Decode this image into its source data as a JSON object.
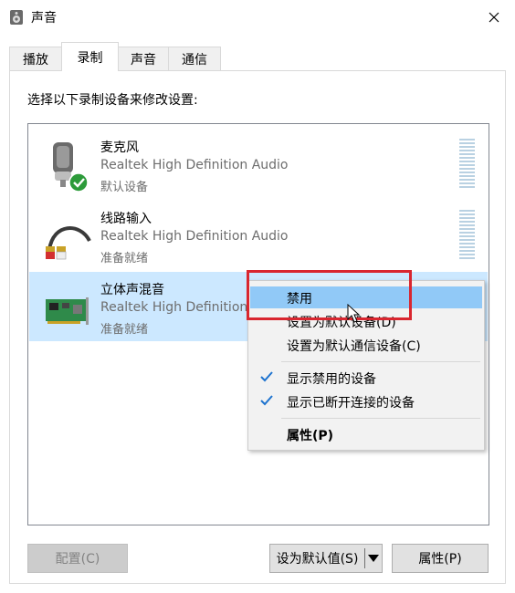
{
  "window": {
    "title": "声音"
  },
  "tabs": [
    {
      "label": "播放"
    },
    {
      "label": "录制"
    },
    {
      "label": "声音"
    },
    {
      "label": "通信"
    }
  ],
  "instruction": "选择以下录制设备来修改设置:",
  "devices": [
    {
      "name": "麦克风",
      "description": "Realtek High Definition Audio",
      "status": "默认设备",
      "icon": "microphone-icon"
    },
    {
      "name": "线路输入",
      "description": "Realtek High Definition Audio",
      "status": "准备就绪",
      "icon": "line-in-cable-icon"
    },
    {
      "name": "立体声混音",
      "description": "Realtek High Definition",
      "status": "准备就绪",
      "icon": "sound-card-icon"
    }
  ],
  "context_menu": {
    "items": [
      {
        "label": "禁用"
      },
      {
        "label": "设置为默认设备(D)"
      },
      {
        "label": "设置为默认通信设备(C)"
      },
      {
        "label": "显示禁用的设备",
        "checked": true
      },
      {
        "label": "显示已断开连接的设备",
        "checked": true
      },
      {
        "label": "属性(P)"
      }
    ]
  },
  "buttons": {
    "configure": "配置(C)",
    "set_default": "设为默认值(S)",
    "properties": "属性(P)"
  },
  "colors": {
    "selection": "#cce8ff",
    "menu_highlight": "#91c9f7",
    "annotation": "#d9262f",
    "check": "#1e73cf"
  }
}
